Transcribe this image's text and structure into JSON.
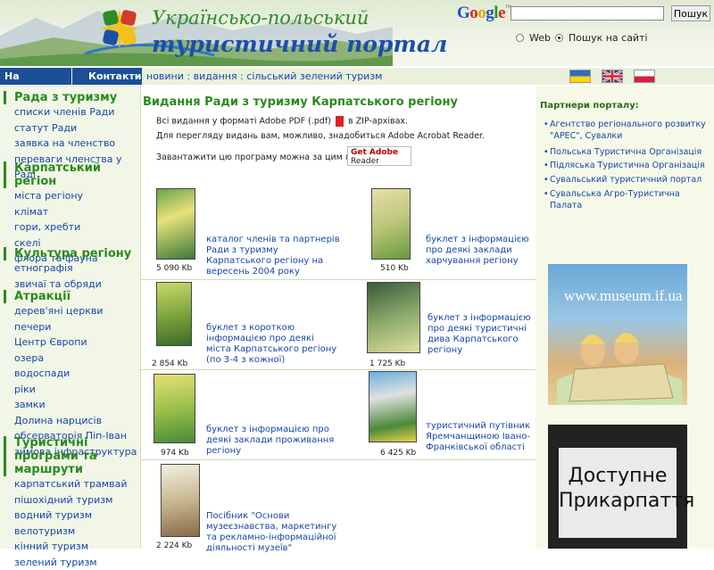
{
  "header": {
    "title_line1": "Українсько-польський",
    "title_line2": "туристичний портал",
    "google": {
      "logo": "Google",
      "search_button": "Пошук",
      "search_value": "",
      "options": [
        {
          "label": "Web",
          "selected": false
        },
        {
          "label": "Пошук на сайті",
          "selected": true
        }
      ]
    }
  },
  "nav": {
    "home": "На головну",
    "contacts": "Контакти",
    "breadcrumb": [
      "новини",
      "видання",
      "сільський зелений туризм"
    ],
    "flags": [
      "flag-ua-icon",
      "flag-gb-icon",
      "flag-pl-icon"
    ]
  },
  "sidebar": [
    {
      "title": "Рада з туризму",
      "items": [
        "списки членів Ради",
        "статут Ради",
        "заявка на членство",
        "переваги членства у Раді"
      ]
    },
    {
      "title": "Карпатський регіон",
      "items": [
        "міста регіону",
        "клімат",
        "гори, хребти",
        "скелі",
        "флора та фауна"
      ]
    },
    {
      "title": "Культура регіону",
      "items": [
        "етнографія",
        "звичаї та обряди"
      ]
    },
    {
      "title": "Атракції",
      "items": [
        "дерев'яні церкви",
        "печери",
        "Центр Європи",
        "озера",
        "водоспади",
        "ріки",
        "замки",
        "Долина нарцисів",
        "обсерваторія Піп-Іван",
        "зимова інфраструктура"
      ]
    },
    {
      "title": "Туристичні програми та маршрути",
      "items": [
        "карпатський трамвай",
        "пішохідний туризм",
        "водний туризм",
        "велотуризм",
        "кінний туризм",
        "зелений туризм"
      ]
    }
  ],
  "main": {
    "title": "Видання Ради з туризму Карпатського регіону",
    "intro_part1": "Всі видання у форматі Adobe PDF (.pdf)",
    "intro_part2": "в ZIP-архівах.",
    "intro_line2": "Для перегляду видань вам, можливо, знадобиться Adobe Acrobat Reader.",
    "intro_line3": "Завантажити цю програму можна за цим посиланням:",
    "adobe_get": "Get Adobe",
    "adobe_reader": "Reader",
    "publications": [
      {
        "label": "каталог членів та партнерів Ради з туризму Карпатського регіону на вересень 2004 року",
        "size": "5 090 Kb"
      },
      {
        "label": "буклет з інформацією про деякі заклади харчування регіону",
        "size": "510 Kb"
      },
      {
        "label": "буклет з короткою інформацією про деякі міста Карпатського регіону (по 3-4 з кожної)",
        "size": "2 854 Kb"
      },
      {
        "label": "буклет з інформацією про деякі туристичні дива Карпатського регіону",
        "size": "1 725 Kb"
      },
      {
        "label": "буклет з інформацією про деякі заклади проживання регіону",
        "size": "974 Kb"
      },
      {
        "label": "туристичний путівник Яремчанщиною Івано-Франківської області",
        "size": "6 425 Kb"
      },
      {
        "label": "Посібник \"Основи музеєзнавства, маркетингу та рекламно-інформаційної діяльності музеїв\"",
        "size": "2 224 Kb"
      }
    ]
  },
  "right": {
    "partners_title": "Партнери порталу:",
    "partners": [
      "Агентство регіонального розвитку \"АРЕС\", Сувалки",
      "Польська Туристична Організація",
      "Підляська Туристична Організація",
      "Сувальський туристичний портал",
      "Сувальська Агро-Туристична Палата"
    ],
    "banner1_text": "www.museum.if.ua",
    "banner2_line1": "Доступне",
    "banner2_line2": "Прикарпаття"
  }
}
